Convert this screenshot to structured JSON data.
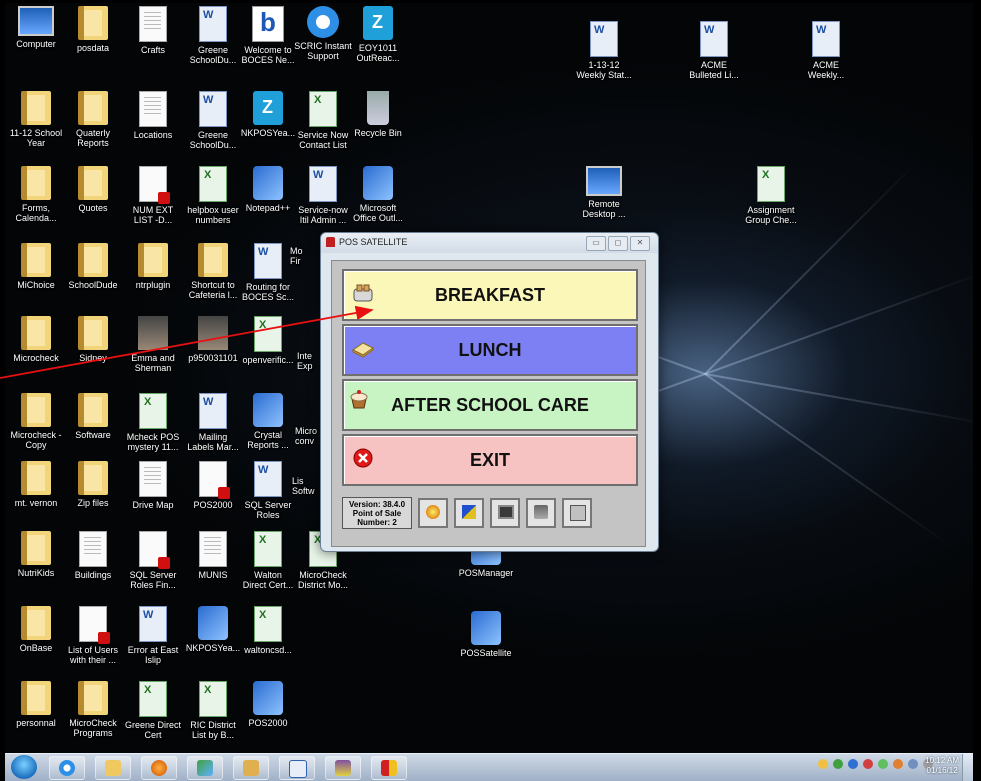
{
  "desktop_icons": [
    {
      "label": "Computer",
      "type": "pc"
    },
    {
      "label": "posdata",
      "type": "folder"
    },
    {
      "label": "Crafts",
      "type": "doc"
    },
    {
      "label": "Greene\nSchoolDu...",
      "type": "word"
    },
    {
      "label": "Welcome to\nBOCES Ne...",
      "type": "b"
    },
    {
      "label": "SCRIC Instant\nSupport",
      "type": "ie"
    },
    {
      "label": "EOY1011\nOutReac...",
      "type": "z"
    },
    {
      "label": "11-12 School\nYear",
      "type": "folder"
    },
    {
      "label": "Quaterly\nReports",
      "type": "folder"
    },
    {
      "label": "Locations",
      "type": "doc"
    },
    {
      "label": "Greene\nSchoolDu...",
      "type": "word"
    },
    {
      "label": "NKPOSYea...",
      "type": "z"
    },
    {
      "label": "Service Now\nContact List",
      "type": "excel"
    },
    {
      "label": "Recycle Bin",
      "type": "bin"
    },
    {
      "label": "Forms,\nCalenda...",
      "type": "folder"
    },
    {
      "label": "Quotes",
      "type": "folder"
    },
    {
      "label": "NUM EXT\nLIST -D...",
      "type": "pdf"
    },
    {
      "label": "helpbox user\nnumbers",
      "type": "excel"
    },
    {
      "label": "Notepad++",
      "type": "exe"
    },
    {
      "label": "Service-now\nItil Admin ...",
      "type": "word"
    },
    {
      "label": "Microsoft\nOffice Outl...",
      "type": "exe"
    },
    {
      "label": "MiChoice",
      "type": "folder"
    },
    {
      "label": "SchoolDude",
      "type": "folder"
    },
    {
      "label": "ntrplugin",
      "type": "folder"
    },
    {
      "label": "Shortcut to\nCafeteria l...",
      "type": "folder"
    },
    {
      "label": "Routing for\nBOCES Sc...",
      "type": "word"
    },
    {
      "label": "Microcheck",
      "type": "folder"
    },
    {
      "label": "Sidney",
      "type": "folder"
    },
    {
      "label": "Emma and\nSherman",
      "type": "photo"
    },
    {
      "label": "p950031101",
      "type": "photo"
    },
    {
      "label": "openverific...",
      "type": "excel"
    },
    {
      "label": "Microcheck -\nCopy",
      "type": "folder"
    },
    {
      "label": "Software",
      "type": "folder"
    },
    {
      "label": "Mcheck POS\nmystery 11...",
      "type": "excel"
    },
    {
      "label": "Mailing\nLabels Mar...",
      "type": "word"
    },
    {
      "label": "Crystal\nReports ...",
      "type": "exe"
    },
    {
      "label": "mt. vernon",
      "type": "folder"
    },
    {
      "label": "Zip files",
      "type": "folder"
    },
    {
      "label": "Drive Map",
      "type": "doc"
    },
    {
      "label": "POS2000",
      "type": "pdf"
    },
    {
      "label": "SQL Server\nRoles",
      "type": "word"
    },
    {
      "label": "NutriKids",
      "type": "folder"
    },
    {
      "label": "Buildings",
      "type": "doc"
    },
    {
      "label": "SQL Server\nRoles Fin...",
      "type": "pdf"
    },
    {
      "label": "MUNIS",
      "type": "doc"
    },
    {
      "label": "Walton\nDirect Cert...",
      "type": "excel"
    },
    {
      "label": "MicroCheck\nDistrict Mo...",
      "type": "excel"
    },
    {
      "label": "OnBase",
      "type": "folder"
    },
    {
      "label": "List of Users\nwith their ...",
      "type": "pdf"
    },
    {
      "label": "Error at East\nIslip",
      "type": "word"
    },
    {
      "label": "NKPOSYea...",
      "type": "exe"
    },
    {
      "label": "waltoncsd...",
      "type": "excel"
    },
    {
      "label": "personnal",
      "type": "folder"
    },
    {
      "label": "MicroCheck\nPrograms",
      "type": "folder"
    },
    {
      "label": "Greene Direct\nCert",
      "type": "excel"
    },
    {
      "label": "RIC District\nList by B...",
      "type": "excel"
    },
    {
      "label": "POS2000",
      "type": "exe"
    },
    {
      "label": "1-13-12\nWeekly Stat...",
      "type": "word"
    },
    {
      "label": "ACME\nBulleted Li...",
      "type": "word"
    },
    {
      "label": "ACME\nWeekly...",
      "type": "word"
    },
    {
      "label": "Remote\nDesktop ...",
      "type": "pc"
    },
    {
      "label": "Assignment\nGroup Che...",
      "type": "excel"
    },
    {
      "label": "POSManager",
      "type": "exe"
    },
    {
      "label": "POSSatellite",
      "type": "exe"
    }
  ],
  "partial_labels": {
    "mo": "Mo\nFir",
    "inte": "Inte\nExp",
    "micro": "Micro\nconv",
    "lis": "Lis\nSoftw"
  },
  "pos_window": {
    "title": "POS SATELLITE",
    "controls": {
      "minimize": "▭",
      "maximize": "◻",
      "close": "✕"
    },
    "buttons": {
      "breakfast": "BREAKFAST",
      "lunch": "LUNCH",
      "after_school": "AFTER SCHOOL CARE",
      "exit": "EXIT"
    },
    "version_line1": "Version: 38.4.0",
    "version_line2": "Point of Sale",
    "version_line3": "Number: 2",
    "colors": {
      "breakfast": "#fbf7b8",
      "lunch": "#7d80f2",
      "after_school": "#c8f4c4",
      "exit": "#f6c2c2"
    }
  },
  "taskbar": {
    "time": "10:12 AM",
    "date": "01/16/12",
    "pinned": [
      "ie-icon",
      "explorer-icon",
      "media-player-icon",
      "network-icon",
      "pos-icon",
      "word-icon",
      "tools-icon",
      "pos-satellite-icon"
    ]
  }
}
